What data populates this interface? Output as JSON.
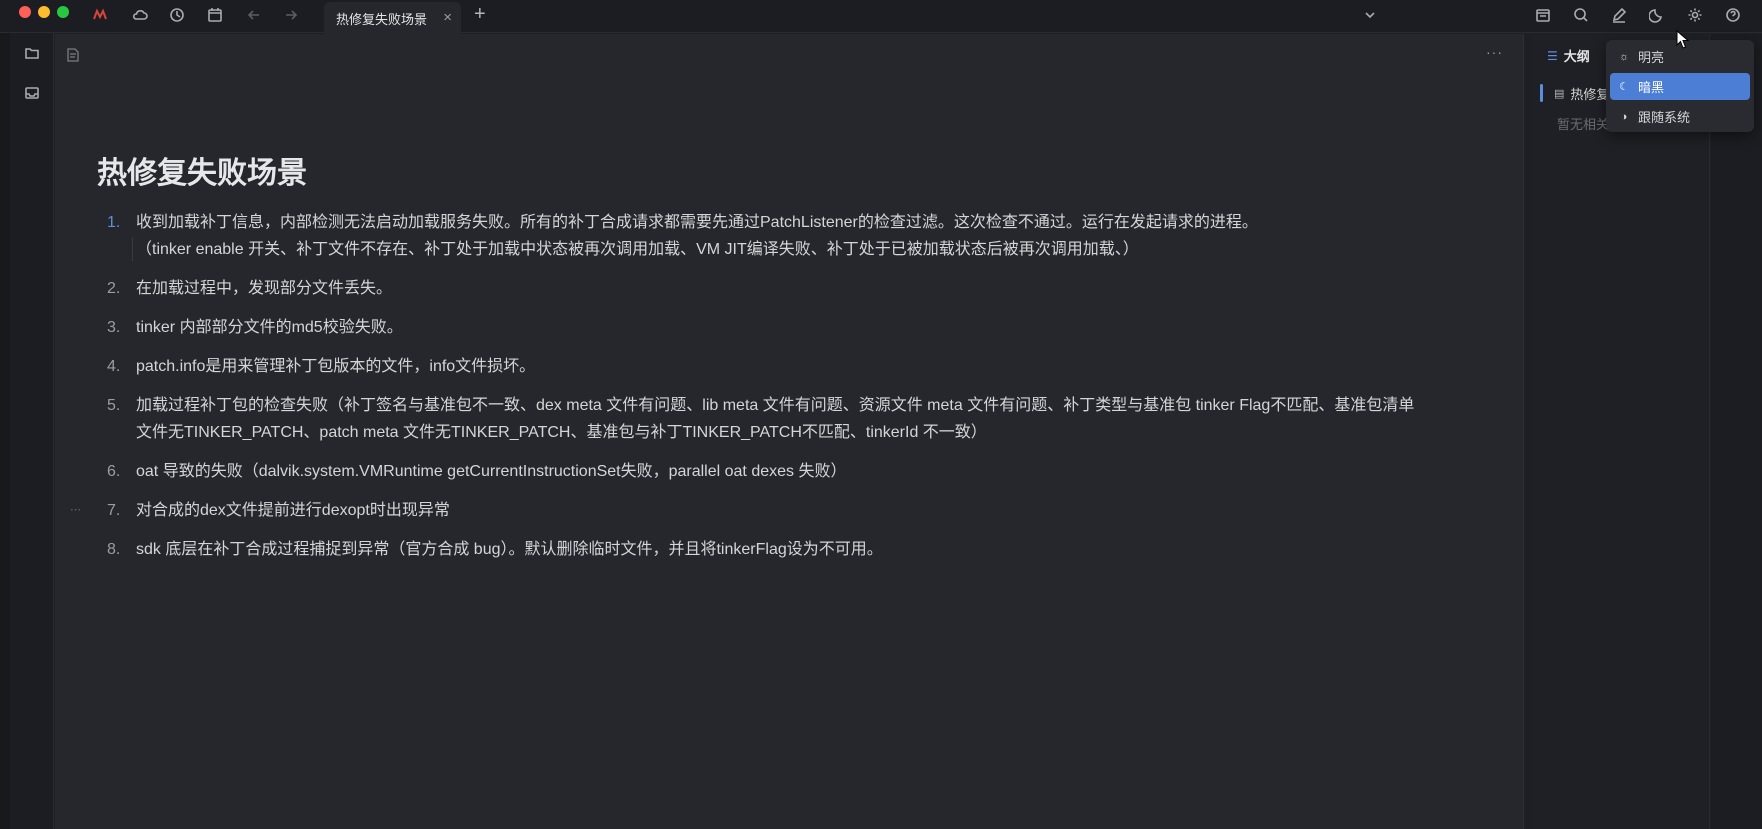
{
  "tab": {
    "title": "热修复失败场景",
    "close": "×",
    "add": "+"
  },
  "document": {
    "title": "热修复失败场景",
    "items": [
      {
        "num": "1.",
        "text": "收到加载补丁信息，内部检测无法启动加载服务失败。所有的补丁合成请求都需要先通过PatchListener的检查过滤。这次检查不通过。运行在发起请求的进程。\n（tinker enable 开关、补丁文件不存在、补丁处于加载中状态被再次调用加载、VM JIT编译失败、补丁处于已被加载状态后被再次调用加载、）"
      },
      {
        "num": "2.",
        "text": "在加载过程中，发现部分文件丢失。"
      },
      {
        "num": "3.",
        "text": "tinker 内部部分文件的md5校验失败。"
      },
      {
        "num": "4.",
        "text": "patch.info是用来管理补丁包版本的文件，info文件损坏。"
      },
      {
        "num": "5.",
        "text": "加载过程补丁包的检查失败（补丁签名与基准包不一致、dex meta 文件有问题、lib meta 文件有问题、资源文件 meta 文件有问题、补丁类型与基准包 tinker Flag不匹配、基准包清单文件无TINKER_PATCH、patch meta 文件无TINKER_PATCH、基准包与补丁TINKER_PATCH不匹配、tinkerId 不一致）"
      },
      {
        "num": "6.",
        "text": "oat 导致的失败（dalvik.system.VMRuntime  getCurrentInstructionSet失败，parallel oat dexes 失败）"
      },
      {
        "num": "7.",
        "text": "对合成的dex文件提前进行dexopt时出现异常"
      },
      {
        "num": "8.",
        "text": "sdk 底层在补丁合成过程捕捉到异常（官方合成 bug）。默认删除临时文件，并且将tinkerFlag设为不可用。"
      }
    ],
    "more": "···"
  },
  "outline": {
    "title": "大纲",
    "item": "热修复",
    "empty": "暂无相关"
  },
  "theme_menu": {
    "items": [
      {
        "icon": "☼",
        "label": "明亮"
      },
      {
        "icon": "☾",
        "label": "暗黑"
      },
      {
        "icon": "◑",
        "label": "跟随系统"
      }
    ],
    "selected": "暗黑"
  },
  "colors": {
    "accent": "#4c7ed6",
    "background": "#26272d",
    "text": "#d4d5d8"
  }
}
